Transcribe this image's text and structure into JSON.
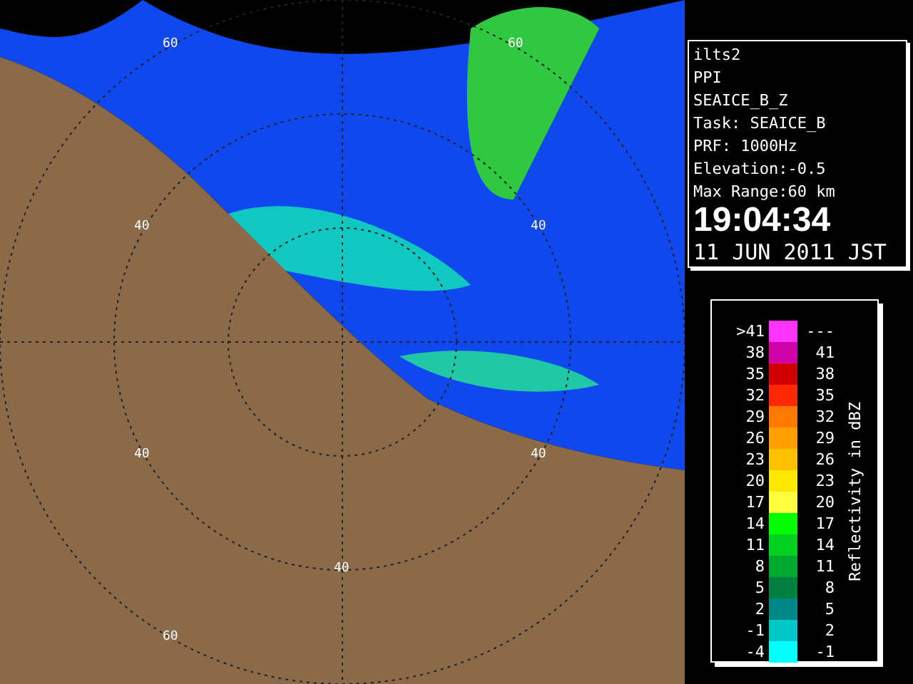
{
  "map": {
    "range_labels": [
      "60",
      "60",
      "40",
      "40",
      "40",
      "40",
      "40",
      "60"
    ]
  },
  "info": {
    "lines": [
      "ilts2",
      "PPI",
      "SEAICE_B_Z",
      "Task: SEAICE_B",
      "PRF: 1000Hz",
      "Elevation:-0.5",
      "Max Range:60 km"
    ],
    "time": "19:04:34",
    "date": "11 JUN 2011 JST"
  },
  "legend": {
    "title": "Reflectivity in dBZ",
    "rows": [
      {
        "low": ">41",
        "high": "---",
        "color": "#ff33ff"
      },
      {
        "low": "38",
        "high": "41",
        "color": "#d000a8"
      },
      {
        "low": "35",
        "high": "38",
        "color": "#d00000"
      },
      {
        "low": "32",
        "high": "35",
        "color": "#ff2800"
      },
      {
        "low": "29",
        "high": "32",
        "color": "#ff7800"
      },
      {
        "low": "26",
        "high": "29",
        "color": "#ffa000"
      },
      {
        "low": "23",
        "high": "26",
        "color": "#ffc000"
      },
      {
        "low": "20",
        "high": "23",
        "color": "#ffe800"
      },
      {
        "low": "17",
        "high": "20",
        "color": "#ffff40"
      },
      {
        "low": "14",
        "high": "17",
        "color": "#00ff00"
      },
      {
        "low": "11",
        "high": "14",
        "color": "#00d020"
      },
      {
        "low": "8",
        "high": "11",
        "color": "#00a830"
      },
      {
        "low": "5",
        "high": "8",
        "color": "#008040"
      },
      {
        "low": "2",
        "high": "5",
        "color": "#008888"
      },
      {
        "low": "-1",
        "high": "2",
        "color": "#00c8c8"
      },
      {
        "low": "-4",
        "high": "-1",
        "color": "#00ffff"
      }
    ]
  }
}
